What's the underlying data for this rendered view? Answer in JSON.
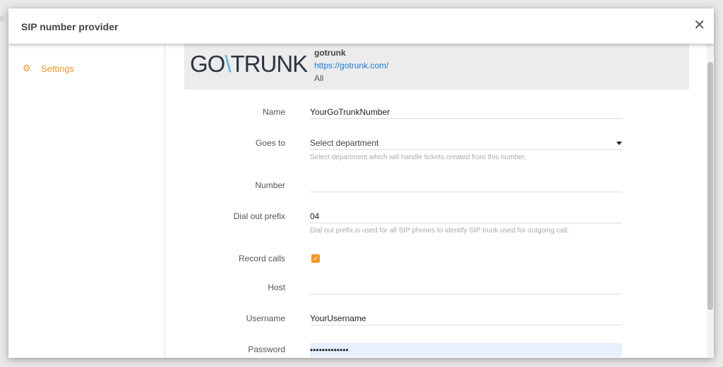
{
  "modal": {
    "title": "SIP number provider",
    "close_icon": "close-icon"
  },
  "sidebar": {
    "items": [
      {
        "label": "Settings",
        "icon": "gear-icon",
        "active": true
      }
    ]
  },
  "provider": {
    "logo": "GO\\TRUNK",
    "name": "gotrunk",
    "url": "https://gotrunk.com/",
    "scope": "All"
  },
  "form": {
    "name": {
      "label": "Name",
      "value": "YourGoTrunkNumber"
    },
    "goes_to": {
      "label": "Goes to",
      "value": "Select department",
      "help": "Select department which will handle tickets created from this number."
    },
    "number": {
      "label": "Number",
      "value": ""
    },
    "dial_prefix": {
      "label": "Dial out prefix",
      "value": "04",
      "help": "Dial out prefix is used for all SIP phones to identify SIP trunk used for outgoing call."
    },
    "record_calls": {
      "label": "Record calls",
      "checked": true
    },
    "host": {
      "label": "Host",
      "value": ""
    },
    "username": {
      "label": "Username",
      "value": "YourUsername"
    },
    "password": {
      "label": "Password",
      "value": "•••••••••••••"
    }
  },
  "colors": {
    "accent": "#f0962e",
    "link": "#1a7bd4"
  }
}
